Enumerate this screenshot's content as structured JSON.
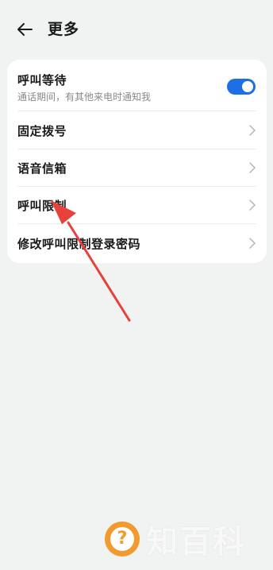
{
  "header": {
    "title": "更多"
  },
  "settings": {
    "call_waiting": {
      "label": "呼叫等待",
      "description": "通话期间，有其他来电时通知我",
      "enabled": true
    },
    "items": [
      {
        "label": "固定拨号"
      },
      {
        "label": "语音信箱"
      },
      {
        "label": "呼叫限制"
      },
      {
        "label": "修改呼叫限制登录密码"
      }
    ]
  },
  "annotation": {
    "color": "#e8403a"
  },
  "watermark": {
    "text": "知百科",
    "color": "#f19a2e"
  }
}
